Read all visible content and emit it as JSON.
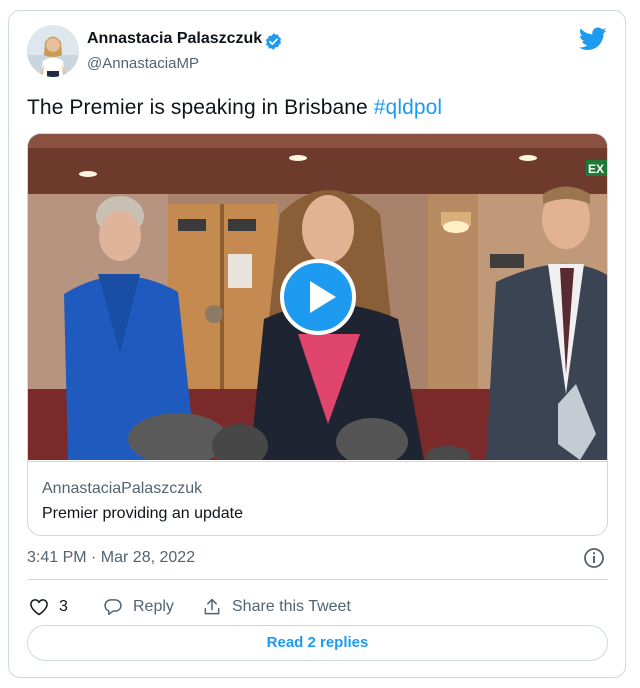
{
  "author": {
    "name": "Annastacia Palaszczuk",
    "handle": "@AnnastaciaMP",
    "verified": true
  },
  "tweet": {
    "text": "The Premier is speaking in Brisbane ",
    "hashtag": "#qldpol"
  },
  "media_card": {
    "source": "AnnastaciaPalaszczuk",
    "title": "Premier providing an update",
    "exit_sign": "EX"
  },
  "meta": {
    "timestamp": "3:41 PM · Mar 28, 2022"
  },
  "actions": {
    "like_count": "3",
    "reply_label": "Reply",
    "share_label": "Share this Tweet"
  },
  "footer": {
    "read_replies_label": "Read 2 replies"
  },
  "colors": {
    "brand_blue": "#1d9bf0",
    "text_primary": "#0f1419",
    "text_secondary": "#536471",
    "border": "#cfd9de"
  },
  "icons": [
    "avatar",
    "verified-badge-icon",
    "twitter-bird-icon",
    "play-icon",
    "info-icon",
    "heart-icon",
    "reply-icon",
    "share-icon"
  ]
}
